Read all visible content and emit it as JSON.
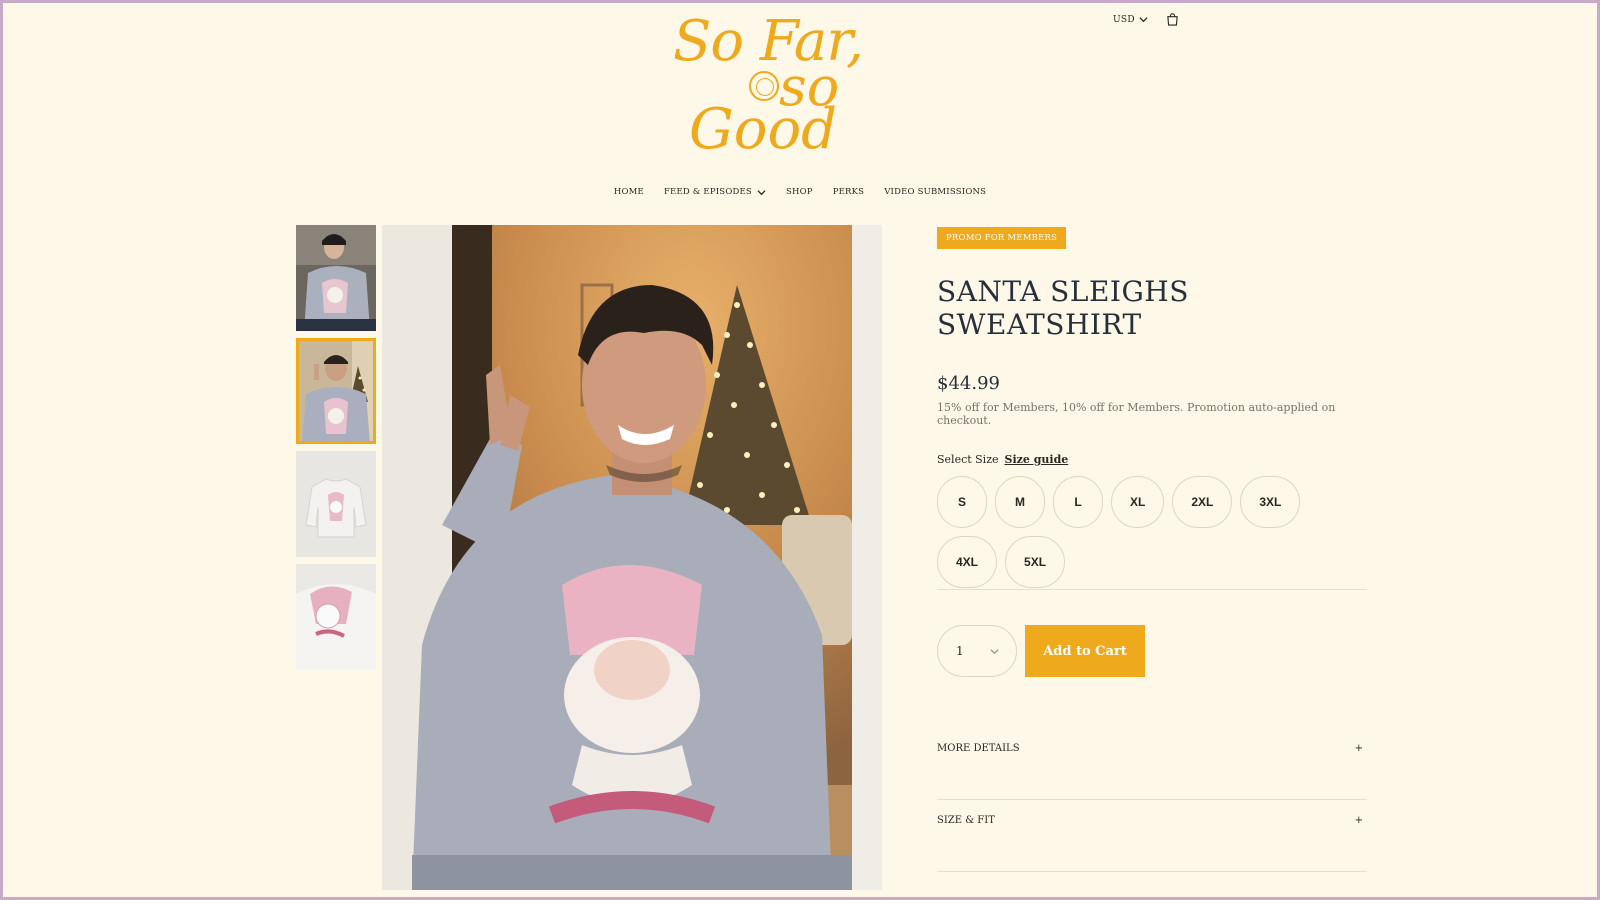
{
  "header": {
    "currency": "USD",
    "logo": {
      "line1": "So Far,",
      "line2": "so",
      "line3": "Good"
    }
  },
  "nav": {
    "items": [
      {
        "label": "HOME"
      },
      {
        "label": "FEED & EPISODES",
        "has_dropdown": true
      },
      {
        "label": "SHOP"
      },
      {
        "label": "PERKS"
      },
      {
        "label": "VIDEO SUBMISSIONS"
      }
    ]
  },
  "gallery": {
    "selected_index": 1,
    "thumbnails": [
      "woman-in-sweatshirt",
      "man-peace-sign",
      "sweatshirt-front-flat",
      "sweatshirt-detail"
    ]
  },
  "product": {
    "promo_badge": "PROMO FOR MEMBERS",
    "title": "SANTA SLEIGHS SWEATSHIRT",
    "price": "$44.99",
    "promo_note": "15% off for Members, 10% off for Members. Promotion auto-applied on checkout.",
    "select_size_label": "Select Size",
    "size_guide_label": "Size guide",
    "sizes": [
      "S",
      "M",
      "L",
      "XL",
      "2XL",
      "3XL",
      "4XL",
      "5XL"
    ],
    "quantity": "1",
    "add_to_cart_label": "Add to Cart",
    "accordions": [
      {
        "label": "MORE DETAILS",
        "icon": "+"
      },
      {
        "label": "SIZE & FIT",
        "icon": "+"
      }
    ]
  },
  "colors": {
    "brand": "#eeaa1c",
    "background": "#fdf8e8",
    "frame": "#c8a9c8"
  }
}
